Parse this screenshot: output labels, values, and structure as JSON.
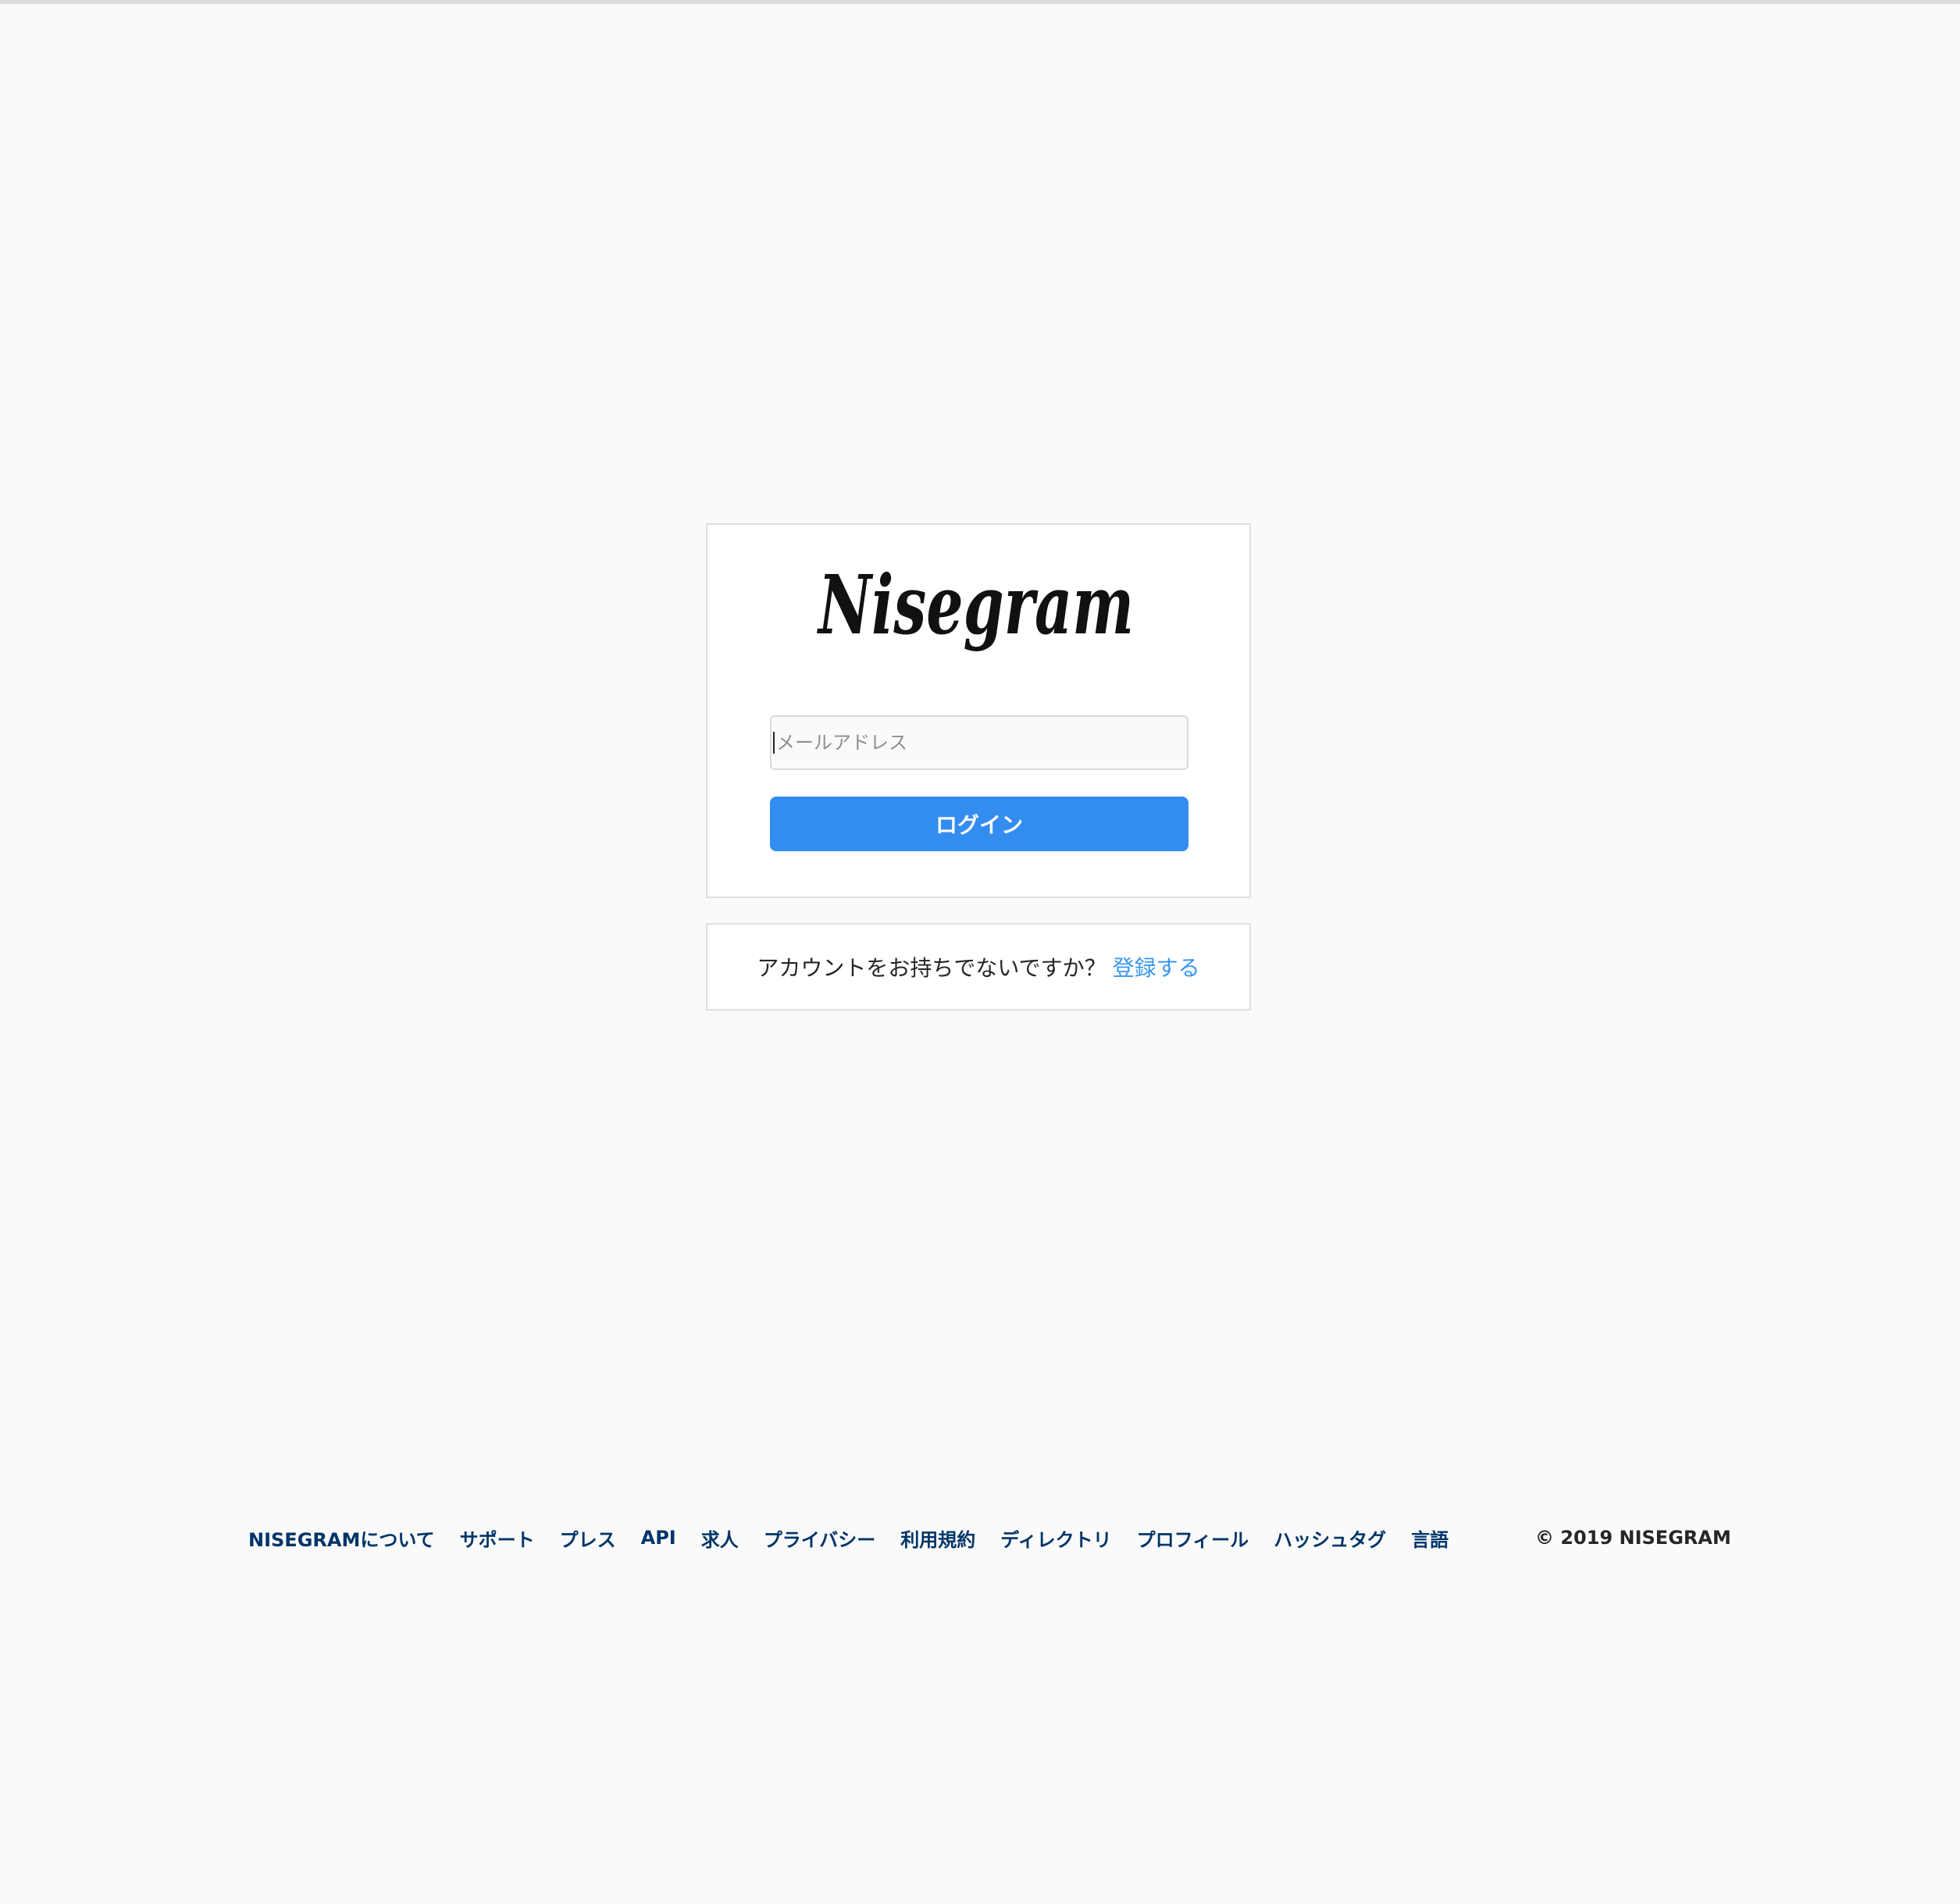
{
  "logo": {
    "text": "Nisegram"
  },
  "login": {
    "email_placeholder": "メールアドレス",
    "email_value": "",
    "login_label": "ログイン"
  },
  "signup": {
    "prompt": "アカウントをお持ちでないですか？",
    "link_label": "登録する"
  },
  "footer": {
    "links": [
      "NISEGRAMについて",
      "サポート",
      "プレス",
      "API",
      "求人",
      "プライバシー",
      "利用規約",
      "ディレクトリ",
      "プロフィール",
      "ハッシュタグ",
      "言語"
    ],
    "copyright": "© 2019 NISEGRAM"
  },
  "colors": {
    "background": "#fafafa",
    "button": "#338cf0",
    "link": "#3897f0",
    "footer_link": "#003569"
  }
}
